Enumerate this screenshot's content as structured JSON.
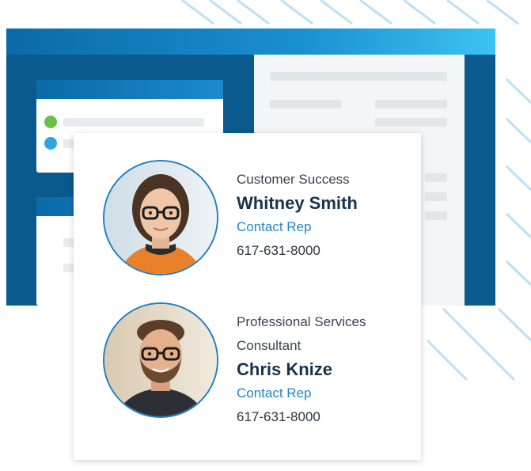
{
  "contacts": [
    {
      "role": "Customer Success",
      "name": "Whitney Smith",
      "link_label": "Contact Rep",
      "phone": "617-631-8000",
      "avatar_icon": "woman-avatar-icon"
    },
    {
      "role": "Professional Services Consultant",
      "name": "Chris Knize",
      "link_label": "Contact Rep",
      "phone": "617-631-8000",
      "avatar_icon": "man-avatar-icon"
    }
  ],
  "colors": {
    "accent": "#1f86c6",
    "name_text": "#16334f",
    "avatar_border": "#1f7fc0",
    "app_dark": "#0a5a8e",
    "status_green": "#6cc04a",
    "status_blue": "#2aa6e0"
  }
}
